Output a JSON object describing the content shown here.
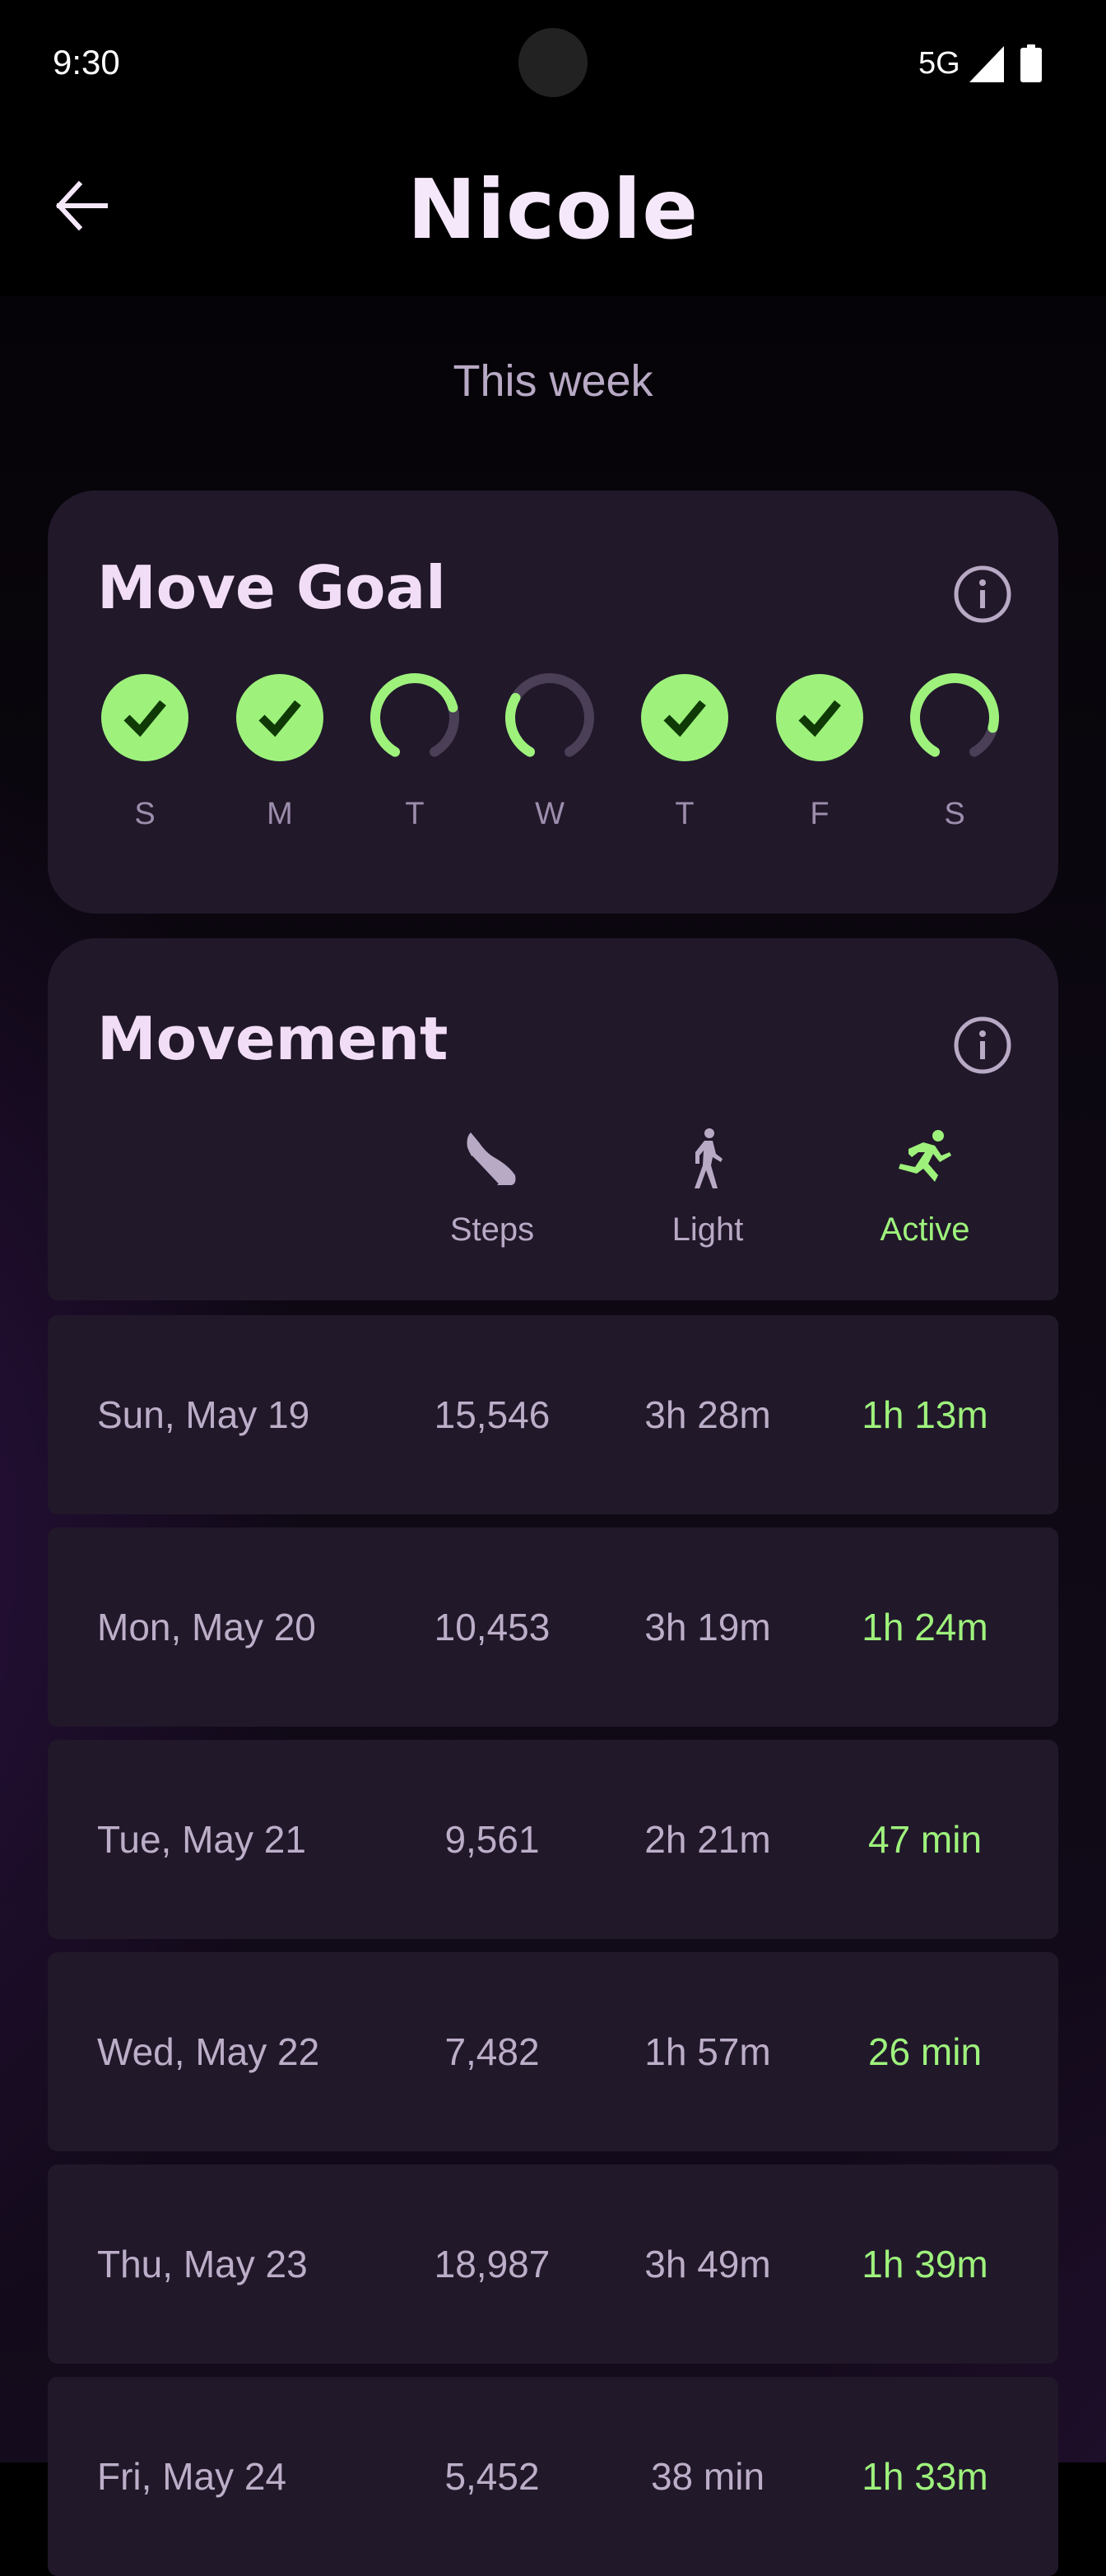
{
  "status_bar": {
    "time": "9:30",
    "network": "5G",
    "icons": [
      "signal-icon",
      "battery-icon"
    ]
  },
  "header": {
    "title": "Nicole",
    "back_icon": "arrow-left-icon",
    "subtitle": "This week"
  },
  "colors": {
    "accent_green": "#9ef27c",
    "card_bg": "#21182a",
    "track_gray": "#4a3f56",
    "title_text": "#f2ddf6",
    "secondary_text": "#b8a9c5",
    "check_color": "#0f3a06"
  },
  "move_goal": {
    "title": "Move Goal",
    "info_icon": "info-icon",
    "days": [
      {
        "label": "S",
        "complete": true,
        "progress": 1.0
      },
      {
        "label": "M",
        "complete": true,
        "progress": 1.0
      },
      {
        "label": "T",
        "complete": false,
        "progress": 0.75
      },
      {
        "label": "W",
        "complete": false,
        "progress": 0.3
      },
      {
        "label": "T",
        "complete": true,
        "progress": 1.0
      },
      {
        "label": "F",
        "complete": true,
        "progress": 1.0
      },
      {
        "label": "S",
        "complete": false,
        "progress": 0.85
      }
    ]
  },
  "movement": {
    "title": "Movement",
    "info_icon": "info-icon",
    "columns": [
      {
        "label": "Steps",
        "icon": "shoe-icon"
      },
      {
        "label": "Light",
        "icon": "walking-icon"
      },
      {
        "label": "Active",
        "icon": "running-icon"
      }
    ],
    "rows": [
      {
        "date": "Sun, May 19",
        "steps": "15,546",
        "light": "3h 28m",
        "active": "1h 13m"
      },
      {
        "date": "Mon, May 20",
        "steps": "10,453",
        "light": "3h 19m",
        "active": "1h 24m"
      },
      {
        "date": "Tue, May 21",
        "steps": "9,561",
        "light": "2h 21m",
        "active": "47 min"
      },
      {
        "date": "Wed, May 22",
        "steps": "7,482",
        "light": "1h 57m",
        "active": "26 min"
      },
      {
        "date": "Thu, May 23",
        "steps": "18,987",
        "light": "3h 49m",
        "active": "1h 39m"
      },
      {
        "date": "Fri, May 24",
        "steps": "5,452",
        "light": "38 min",
        "active": "1h 33m"
      }
    ]
  }
}
